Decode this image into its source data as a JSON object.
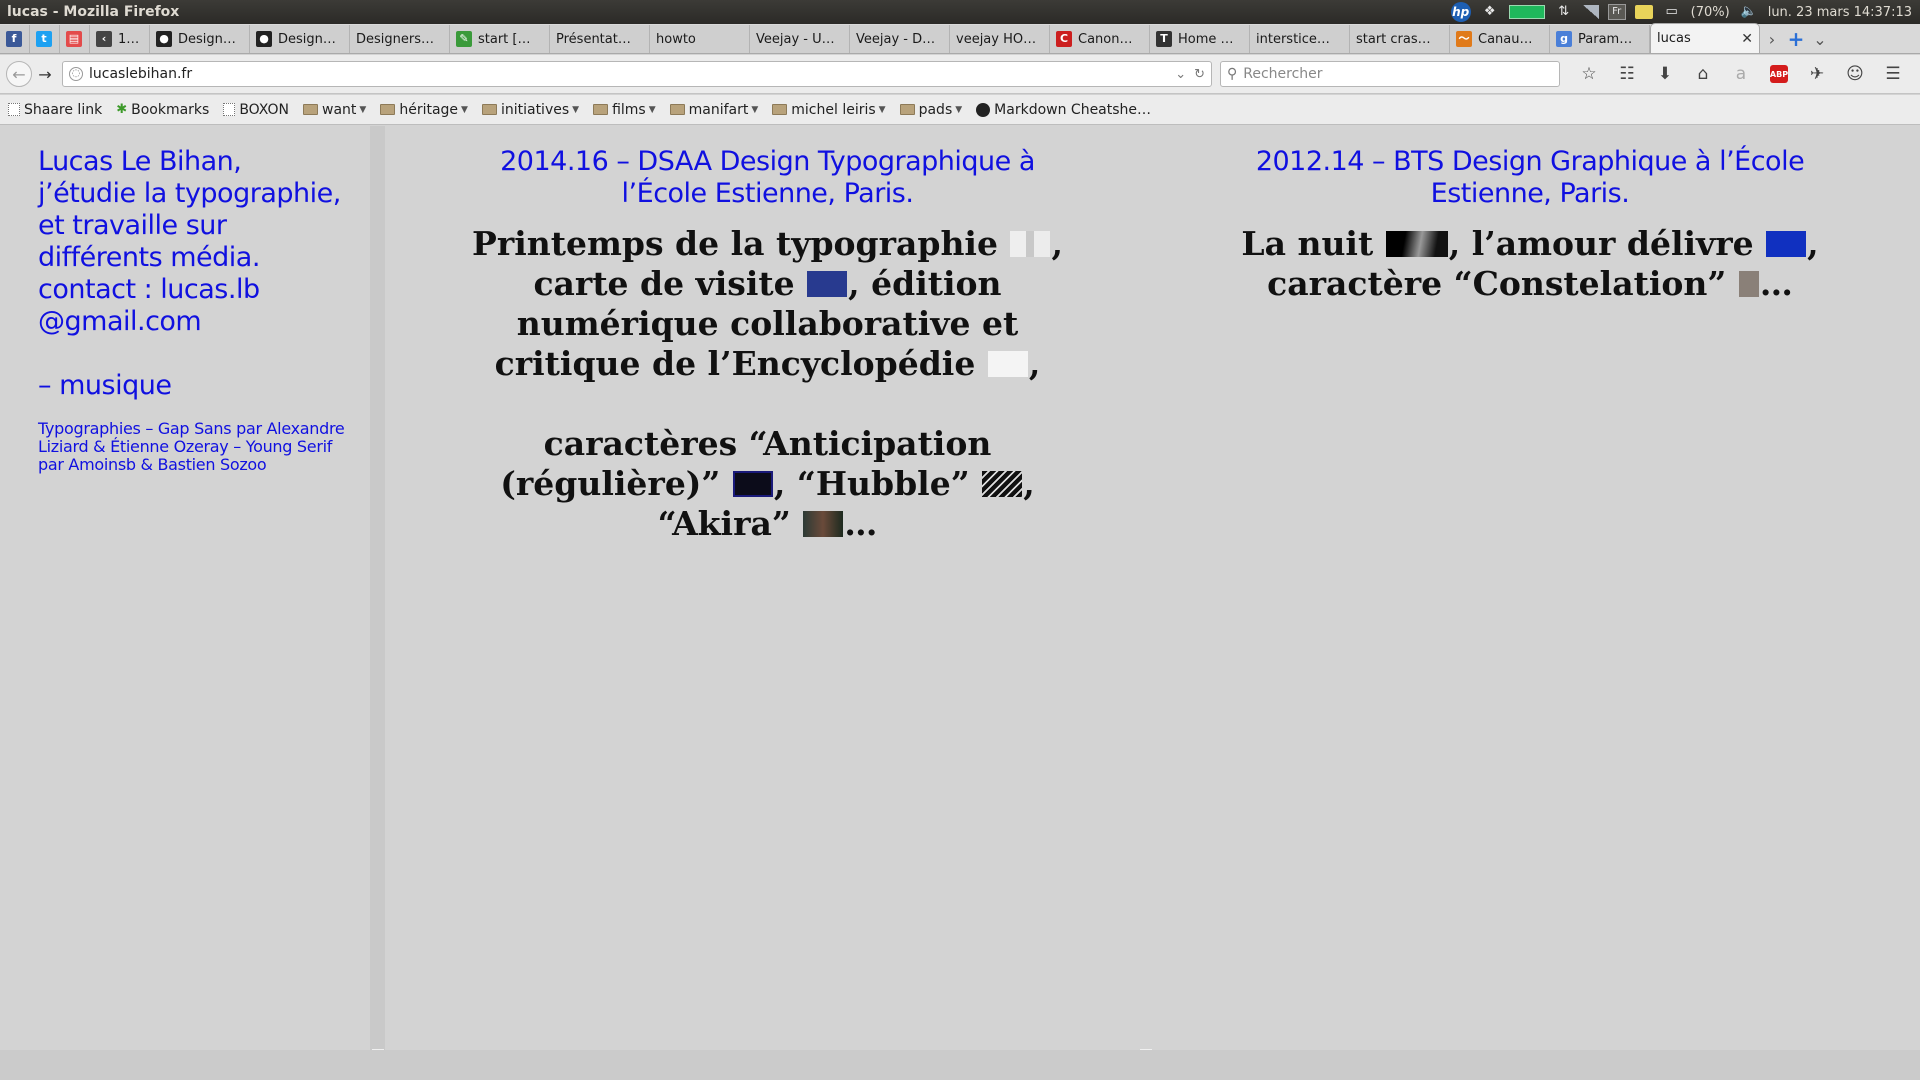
{
  "system_panel": {
    "window_title": "lucas - Mozilla Firefox",
    "keyboard_layout": "Fr",
    "battery": "(70%)",
    "datetime": "lun. 23 mars 14:37:13"
  },
  "tabs": [
    {
      "label": "",
      "icon": "facebook-icon",
      "color": "#3b5998"
    },
    {
      "label": "",
      "icon": "twitter-icon",
      "color": "#1da1f2"
    },
    {
      "label": "",
      "icon": "page-icon",
      "color": "#e34b4b"
    },
    {
      "label": "1…",
      "icon": "back-arrow-icon",
      "color": "#444444"
    },
    {
      "label": "Design…",
      "icon": "github-icon",
      "color": "#222222"
    },
    {
      "label": "Design…",
      "icon": "github-icon",
      "color": "#222222"
    },
    {
      "label": "Designers…",
      "icon": "",
      "color": ""
    },
    {
      "label": "start […",
      "icon": "pencil-icon",
      "color": "#3a9a3a"
    },
    {
      "label": "Présentat…",
      "icon": "",
      "color": ""
    },
    {
      "label": "howto",
      "icon": "",
      "color": ""
    },
    {
      "label": "Veejay - U…",
      "icon": "",
      "color": ""
    },
    {
      "label": "Veejay - D…",
      "icon": "",
      "color": ""
    },
    {
      "label": "veejay HO…",
      "icon": "",
      "color": ""
    },
    {
      "label": "Canon…",
      "icon": "canon-icon",
      "color": "#cc1f1f"
    },
    {
      "label": "Home …",
      "icon": "t-icon",
      "color": "#333333"
    },
    {
      "label": "interstice…",
      "icon": "",
      "color": ""
    },
    {
      "label": "start cras…",
      "icon": "",
      "color": ""
    },
    {
      "label": "Canau…",
      "icon": "wave-icon",
      "color": "#e07a1a"
    },
    {
      "label": "Param…",
      "icon": "google-icon",
      "color": "#4a7fd8"
    },
    {
      "label": "lucas",
      "icon": "",
      "color": "",
      "active": true
    }
  ],
  "navbar": {
    "url": "lucaslebihan.fr",
    "search_placeholder": "Rechercher"
  },
  "bookmarks": [
    {
      "label": "Shaare link",
      "icon": "page",
      "folder": false
    },
    {
      "label": "Bookmarks",
      "icon": "star",
      "folder": false
    },
    {
      "label": "BOXON",
      "icon": "page",
      "folder": false
    },
    {
      "label": "want",
      "icon": "folder",
      "folder": true
    },
    {
      "label": "héritage",
      "icon": "folder",
      "folder": true
    },
    {
      "label": "initiatives",
      "icon": "folder",
      "folder": true
    },
    {
      "label": "films",
      "icon": "folder",
      "folder": true
    },
    {
      "label": "manifart",
      "icon": "folder",
      "folder": true
    },
    {
      "label": "michel leiris",
      "icon": "folder",
      "folder": true
    },
    {
      "label": "pads",
      "icon": "folder",
      "folder": true
    },
    {
      "label": "Markdown Cheatshe…",
      "icon": "github",
      "folder": false
    }
  ],
  "page": {
    "left": {
      "bio": "Lucas Le Bihan, j’étudie la typographie, et travaille sur différents média.",
      "contact": "contact : lucas.lb @gmail.com",
      "music": "– musique",
      "credits": "Typographies – Gap Sans par Alexandre Liziard & Étienne Ozeray – Young Serif par Amoinsb & Bastien Sozoo"
    },
    "middle": {
      "heading": "2014.16 – DSAA Design Typographique à l’École Estienne, Paris.",
      "p1_a": "Printemps de la typographie",
      "p1_b": ", carte de visite",
      "p1_c": ", édition numérique collaborative et critique de l’Encyclopédie",
      "p1_d": ",",
      "p2_a": "caractères “Anticipation (régulière)”",
      "p2_b": ", “Hubble”",
      "p2_c": ", “Akira”",
      "p2_d": "…"
    },
    "right": {
      "heading": "2012.14 – BTS Design Graphique à l’École Estienne, Paris.",
      "p1_a": "La nuit",
      "p1_b": ", l’amour délivre",
      "p1_c": ", caractère “Constelation”",
      "p1_d": "…"
    }
  },
  "colors": {
    "link_blue": "#1010e0",
    "page_bg": "#d3d3d3"
  }
}
